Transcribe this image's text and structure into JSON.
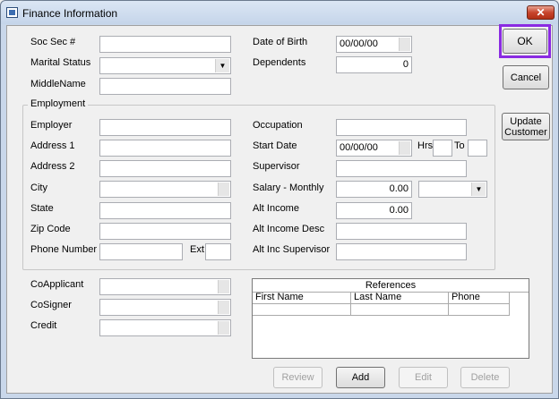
{
  "window": {
    "title": "Finance Information",
    "close_label": "✕"
  },
  "personal": {
    "ssn_label": "Soc Sec #",
    "marital_label": "Marital Status",
    "middlename_label": "MiddleName",
    "dob_label": "Date of Birth",
    "dob_value": "00/00/00",
    "dependents_label": "Dependents",
    "dependents_value": "0"
  },
  "employment": {
    "group_title": "Employment",
    "employer_label": "Employer",
    "address1_label": "Address 1",
    "address2_label": "Address 2",
    "city_label": "City",
    "state_label": "State",
    "zip_label": "Zip Code",
    "phone_label": "Phone Number",
    "ext_label": "Ext",
    "occupation_label": "Occupation",
    "start_date_label": "Start Date",
    "start_date_value": "00/00/00",
    "hrs_label": "Hrs",
    "to_label": "To",
    "supervisor_label": "Supervisor",
    "salary_label": "Salary - Monthly",
    "salary_value": "0.00",
    "alt_income_label": "Alt Income",
    "alt_income_value": "0.00",
    "alt_income_desc_label": "Alt Income Desc",
    "alt_inc_supervisor_label": "Alt Inc Supervisor"
  },
  "other": {
    "coapplicant_label": "CoApplicant",
    "cosigner_label": "CoSigner",
    "credit_label": "Credit"
  },
  "references": {
    "title": "References",
    "columns": [
      "First Name",
      "Last Name",
      "Phone"
    ]
  },
  "buttons": {
    "ok": "OK",
    "cancel": "Cancel",
    "update_customer_line1": "Update",
    "update_customer_line2": "Customer",
    "review": "Review",
    "add": "Add",
    "edit": "Edit",
    "delete": "Delete"
  },
  "colors": {
    "highlight": "#8a2be2",
    "close_button": "#c8452c"
  }
}
